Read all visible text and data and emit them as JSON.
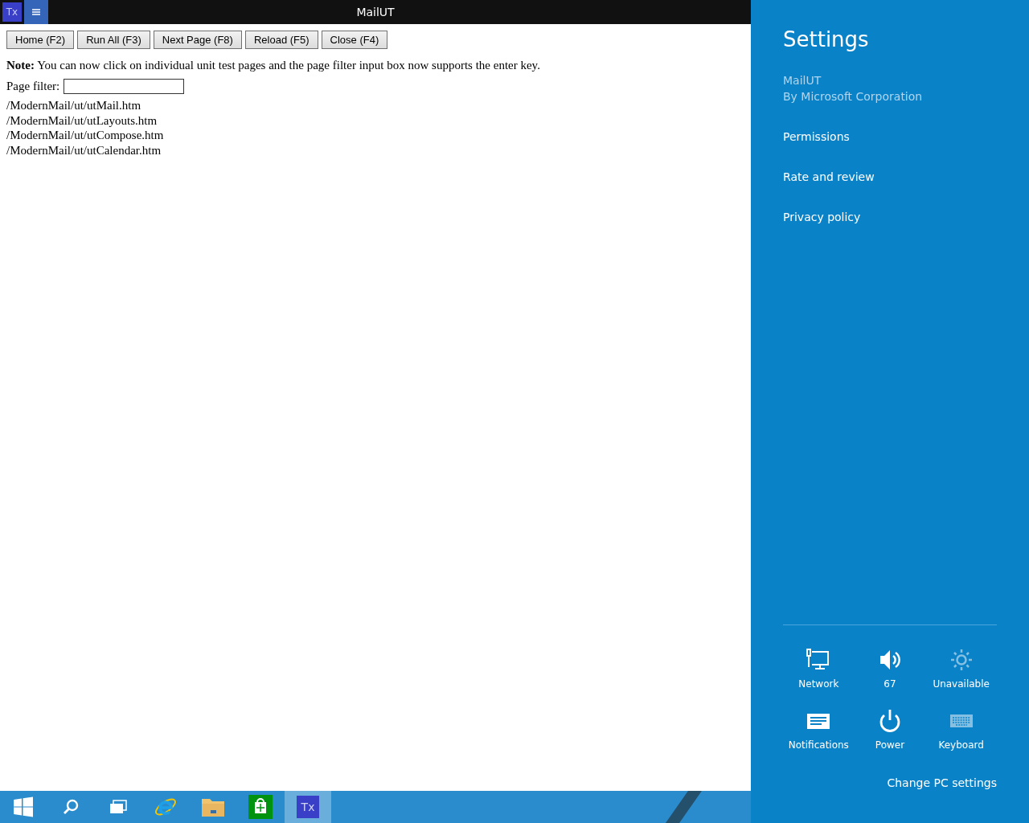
{
  "title_bar": {
    "app_badge": "Tx",
    "title": "MailUT"
  },
  "toolbar": [
    "Home (F2)",
    "Run All (F3)",
    "Next Page (F8)",
    "Reload (F5)",
    "Close (F4)"
  ],
  "note": "**Note:** You can now click on individual unit test pages and the page filter input box now supports the enter key.",
  "filter": {
    "label": "Page filter:"
  },
  "pages": [
    "/ModernMail/ut/utMail.htm",
    "/ModernMail/ut/utLayouts.htm",
    "/ModernMail/ut/utCompose.htm",
    "/ModernMail/ut/utCalendar.htm"
  ],
  "settings": {
    "title": "Settings",
    "app_name": "MailUT",
    "publisher": "By Microsoft Corporation",
    "links": [
      "Permissions",
      "Rate and review",
      "Privacy policy"
    ],
    "quick": [
      {
        "kind": "network",
        "label": "Network",
        "disabled": false
      },
      {
        "kind": "volume",
        "label": "67",
        "disabled": false
      },
      {
        "kind": "brightness",
        "label": "Unavailable",
        "disabled": true
      },
      {
        "kind": "notifications",
        "label": "Notifications",
        "disabled": false
      },
      {
        "kind": "power",
        "label": "Power",
        "disabled": false
      },
      {
        "kind": "keyboard",
        "label": "Keyboard",
        "disabled": true
      }
    ],
    "change_link": "Change PC settings"
  },
  "taskbar": [
    {
      "kind": "start",
      "selected": false
    },
    {
      "kind": "search",
      "selected": false
    },
    {
      "kind": "task-view",
      "selected": false
    },
    {
      "kind": "browser",
      "selected": false
    },
    {
      "kind": "folder",
      "selected": false
    },
    {
      "kind": "store",
      "selected": false
    },
    {
      "kind": "app",
      "label": "Tx",
      "selected": true
    }
  ]
}
